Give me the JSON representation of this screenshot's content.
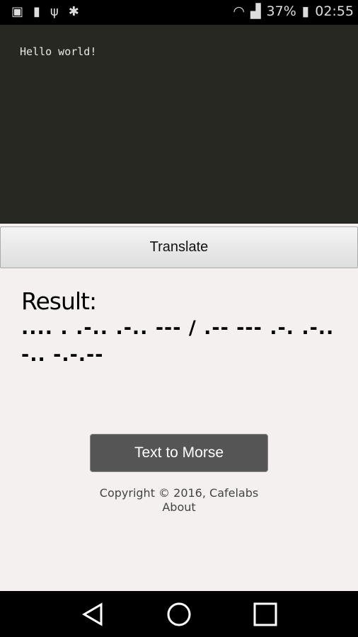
{
  "status_bar": {
    "battery_percent": "37%",
    "time": "02:55",
    "icons": [
      "image-icon",
      "battery-usb-icon",
      "usb-icon",
      "bug-icon",
      "wifi-icon",
      "signal-icon",
      "battery-charging-icon"
    ]
  },
  "editor": {
    "value": "Hello world!"
  },
  "translate_label": "Translate",
  "result": {
    "heading": "Result:",
    "morse": ".... . .-.. .-.. --- / .-- --- .-. .-.. -.. -.-.--"
  },
  "mode_button_label": "Text to Morse",
  "footer": {
    "copyright": "Copyright © 2016, Cafelabs",
    "about": "About"
  },
  "nav": [
    "back-icon",
    "home-icon",
    "recents-icon"
  ]
}
